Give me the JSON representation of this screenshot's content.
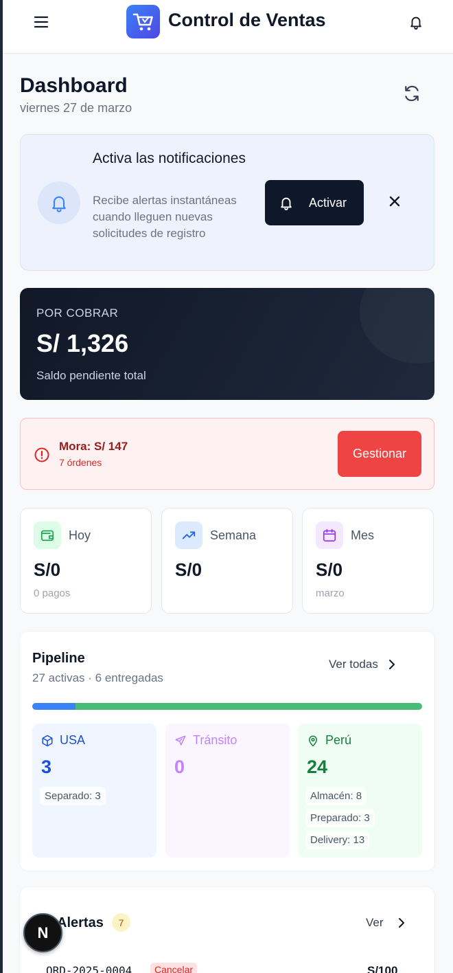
{
  "header": {
    "title": "Control de Ventas"
  },
  "dashboard": {
    "title": "Dashboard",
    "date": "viernes 27 de marzo"
  },
  "notification_banner": {
    "title": "Activa las notificaciones",
    "description": "Recibe alertas instantáneas cuando lleguen nuevas solicitudes de registro",
    "activate_label": "Activar"
  },
  "receivable": {
    "label": "POR COBRAR",
    "amount": "S/ 1,326",
    "subtitle": "Saldo pendiente total"
  },
  "overdue": {
    "title": "Mora: S/ 147",
    "subtitle": "7 órdenes",
    "button_label": "Gestionar"
  },
  "stats": [
    {
      "name": "Hoy",
      "value": "S/0",
      "foot": "0 pagos",
      "icon": "wallet-icon",
      "color": "#16a34a",
      "bg": "#dcfce7"
    },
    {
      "name": "Semana",
      "value": "S/0",
      "foot": "",
      "icon": "trending-up-icon",
      "color": "#2563eb",
      "bg": "#dbeafe"
    },
    {
      "name": "Mes",
      "value": "S/0",
      "foot": "marzo",
      "icon": "calendar-icon",
      "color": "#9333ea",
      "bg": "#f3e8ff"
    }
  ],
  "pipeline": {
    "title": "Pipeline",
    "subtitle": "27 activas · 6 entregadas",
    "link_label": "Ver todas",
    "progress": {
      "usa": 3,
      "transit": 0,
      "peru": 24
    },
    "stages": [
      {
        "name": "USA",
        "count": "3",
        "details": [
          "Separado: 3"
        ],
        "icon": "package-icon",
        "color": "#1d4ed8",
        "bg": "#eff6ff"
      },
      {
        "name": "Tránsito",
        "count": "0",
        "details": [],
        "icon": "plane-icon",
        "color": "#c084fc",
        "bg": "#faf5ff"
      },
      {
        "name": "Perú",
        "count": "24",
        "details": [
          "Almacén: 8",
          "Preparado: 3",
          "Delivery: 13"
        ],
        "icon": "map-pin-icon",
        "color": "#15803d",
        "bg": "#f0fdf4"
      }
    ]
  },
  "alerts": {
    "title": "Alertas",
    "count": "7",
    "link_label": "Ver",
    "first_order": {
      "code": "ORD-2025-0004",
      "tag": "Cancelar",
      "amount": "S/100"
    }
  },
  "fab": {
    "label": "N"
  }
}
